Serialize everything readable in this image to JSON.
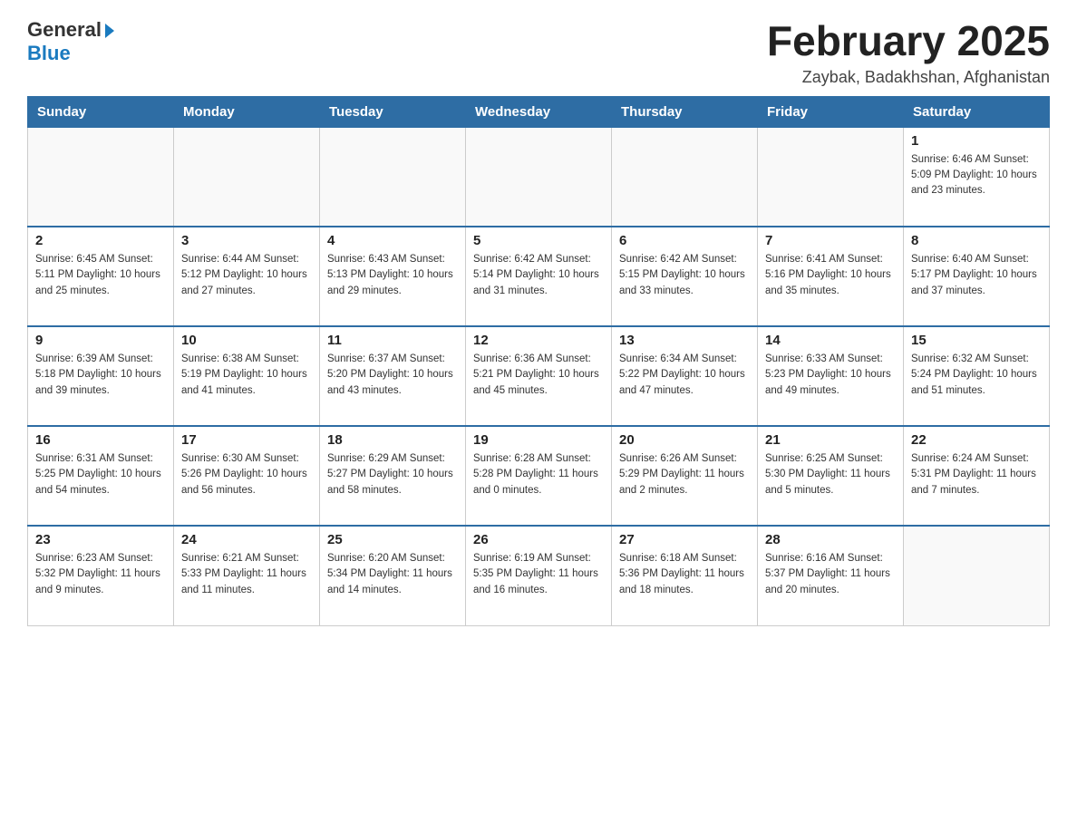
{
  "header": {
    "logo_general": "General",
    "logo_blue": "Blue",
    "month_title": "February 2025",
    "location": "Zaybak, Badakhshan, Afghanistan"
  },
  "weekdays": [
    "Sunday",
    "Monday",
    "Tuesday",
    "Wednesday",
    "Thursday",
    "Friday",
    "Saturday"
  ],
  "weeks": [
    [
      {
        "day": "",
        "info": ""
      },
      {
        "day": "",
        "info": ""
      },
      {
        "day": "",
        "info": ""
      },
      {
        "day": "",
        "info": ""
      },
      {
        "day": "",
        "info": ""
      },
      {
        "day": "",
        "info": ""
      },
      {
        "day": "1",
        "info": "Sunrise: 6:46 AM\nSunset: 5:09 PM\nDaylight: 10 hours and 23 minutes."
      }
    ],
    [
      {
        "day": "2",
        "info": "Sunrise: 6:45 AM\nSunset: 5:11 PM\nDaylight: 10 hours and 25 minutes."
      },
      {
        "day": "3",
        "info": "Sunrise: 6:44 AM\nSunset: 5:12 PM\nDaylight: 10 hours and 27 minutes."
      },
      {
        "day": "4",
        "info": "Sunrise: 6:43 AM\nSunset: 5:13 PM\nDaylight: 10 hours and 29 minutes."
      },
      {
        "day": "5",
        "info": "Sunrise: 6:42 AM\nSunset: 5:14 PM\nDaylight: 10 hours and 31 minutes."
      },
      {
        "day": "6",
        "info": "Sunrise: 6:42 AM\nSunset: 5:15 PM\nDaylight: 10 hours and 33 minutes."
      },
      {
        "day": "7",
        "info": "Sunrise: 6:41 AM\nSunset: 5:16 PM\nDaylight: 10 hours and 35 minutes."
      },
      {
        "day": "8",
        "info": "Sunrise: 6:40 AM\nSunset: 5:17 PM\nDaylight: 10 hours and 37 minutes."
      }
    ],
    [
      {
        "day": "9",
        "info": "Sunrise: 6:39 AM\nSunset: 5:18 PM\nDaylight: 10 hours and 39 minutes."
      },
      {
        "day": "10",
        "info": "Sunrise: 6:38 AM\nSunset: 5:19 PM\nDaylight: 10 hours and 41 minutes."
      },
      {
        "day": "11",
        "info": "Sunrise: 6:37 AM\nSunset: 5:20 PM\nDaylight: 10 hours and 43 minutes."
      },
      {
        "day": "12",
        "info": "Sunrise: 6:36 AM\nSunset: 5:21 PM\nDaylight: 10 hours and 45 minutes."
      },
      {
        "day": "13",
        "info": "Sunrise: 6:34 AM\nSunset: 5:22 PM\nDaylight: 10 hours and 47 minutes."
      },
      {
        "day": "14",
        "info": "Sunrise: 6:33 AM\nSunset: 5:23 PM\nDaylight: 10 hours and 49 minutes."
      },
      {
        "day": "15",
        "info": "Sunrise: 6:32 AM\nSunset: 5:24 PM\nDaylight: 10 hours and 51 minutes."
      }
    ],
    [
      {
        "day": "16",
        "info": "Sunrise: 6:31 AM\nSunset: 5:25 PM\nDaylight: 10 hours and 54 minutes."
      },
      {
        "day": "17",
        "info": "Sunrise: 6:30 AM\nSunset: 5:26 PM\nDaylight: 10 hours and 56 minutes."
      },
      {
        "day": "18",
        "info": "Sunrise: 6:29 AM\nSunset: 5:27 PM\nDaylight: 10 hours and 58 minutes."
      },
      {
        "day": "19",
        "info": "Sunrise: 6:28 AM\nSunset: 5:28 PM\nDaylight: 11 hours and 0 minutes."
      },
      {
        "day": "20",
        "info": "Sunrise: 6:26 AM\nSunset: 5:29 PM\nDaylight: 11 hours and 2 minutes."
      },
      {
        "day": "21",
        "info": "Sunrise: 6:25 AM\nSunset: 5:30 PM\nDaylight: 11 hours and 5 minutes."
      },
      {
        "day": "22",
        "info": "Sunrise: 6:24 AM\nSunset: 5:31 PM\nDaylight: 11 hours and 7 minutes."
      }
    ],
    [
      {
        "day": "23",
        "info": "Sunrise: 6:23 AM\nSunset: 5:32 PM\nDaylight: 11 hours and 9 minutes."
      },
      {
        "day": "24",
        "info": "Sunrise: 6:21 AM\nSunset: 5:33 PM\nDaylight: 11 hours and 11 minutes."
      },
      {
        "day": "25",
        "info": "Sunrise: 6:20 AM\nSunset: 5:34 PM\nDaylight: 11 hours and 14 minutes."
      },
      {
        "day": "26",
        "info": "Sunrise: 6:19 AM\nSunset: 5:35 PM\nDaylight: 11 hours and 16 minutes."
      },
      {
        "day": "27",
        "info": "Sunrise: 6:18 AM\nSunset: 5:36 PM\nDaylight: 11 hours and 18 minutes."
      },
      {
        "day": "28",
        "info": "Sunrise: 6:16 AM\nSunset: 5:37 PM\nDaylight: 11 hours and 20 minutes."
      },
      {
        "day": "",
        "info": ""
      }
    ]
  ]
}
